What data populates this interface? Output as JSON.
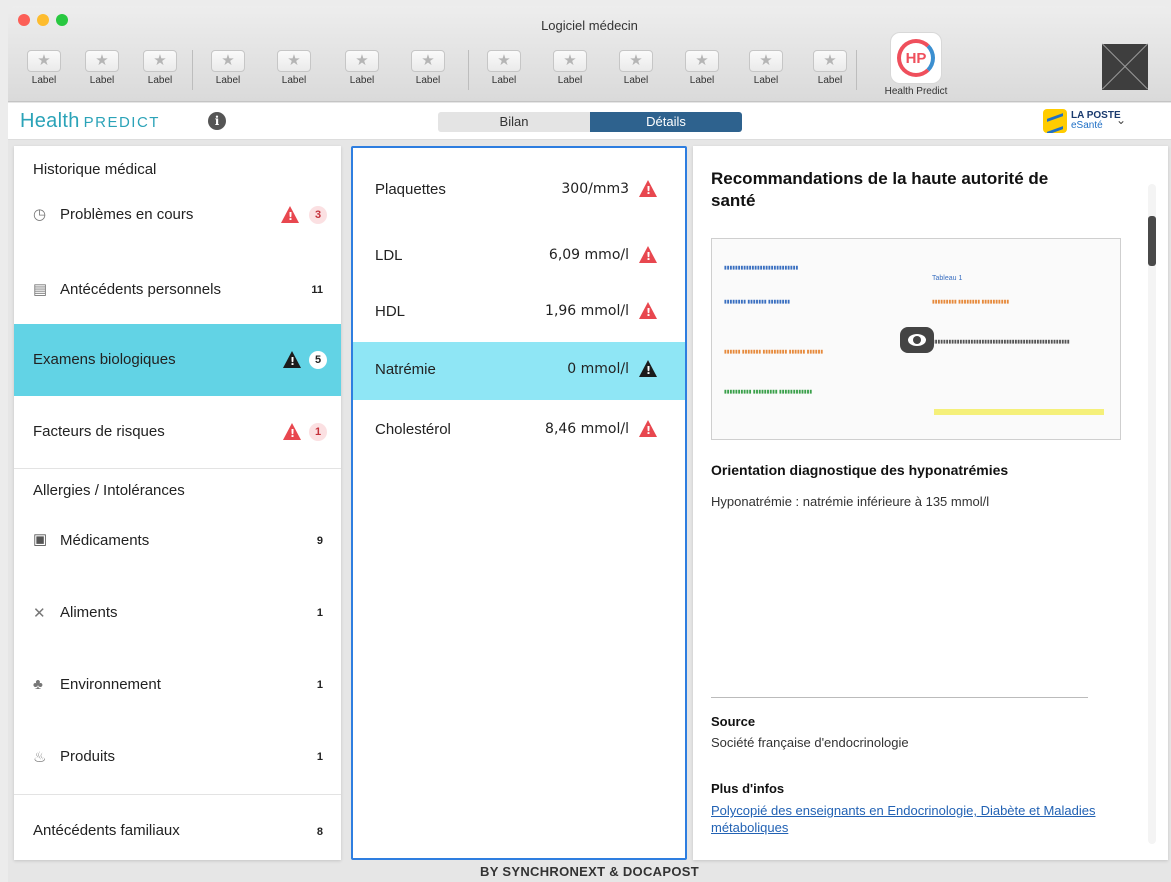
{
  "window": {
    "title": "Logiciel médecin"
  },
  "toolbar": {
    "buttons": [
      "Label",
      "Label",
      "Label",
      "Label",
      "Label",
      "Label",
      "Label",
      "Label",
      "Label",
      "Label",
      "Label",
      "Label",
      "Label"
    ],
    "app_label": "Health Predict",
    "app_logo_text": "HP"
  },
  "header": {
    "brand_main": "Health",
    "brand_sub": "PREDICT",
    "info_icon": "i",
    "tabs": [
      "Bilan",
      "Détails"
    ],
    "active_tab": "Détails",
    "partner_line1": "LA POSTE",
    "partner_line2": "eSanté",
    "chevron": "⌄"
  },
  "sidebar": {
    "history_title": "Historique médical",
    "problems": {
      "label": "Problèmes en cours",
      "count": "3"
    },
    "antecedents": {
      "label": "Antécédents personnels",
      "count": "11"
    },
    "exams": {
      "label": "Examens biologiques",
      "count": "5"
    },
    "risks": {
      "label": "Facteurs de risques",
      "count": "1"
    },
    "allergies_title": "Allergies / Intolérances",
    "medicaments": {
      "label": "Médicaments",
      "count": "9"
    },
    "aliments": {
      "label": "Aliments",
      "count": "1"
    },
    "environnement": {
      "label": "Environnement",
      "count": "1"
    },
    "produits": {
      "label": "Produits",
      "count": "1"
    },
    "familiaux": {
      "label": "Antécédents familiaux",
      "count": "8"
    }
  },
  "exams_list": [
    {
      "name": "Plaquettes",
      "value": "300/mm3"
    },
    {
      "name": "LDL",
      "value": "6,09 mmo/l"
    },
    {
      "name": "HDL",
      "value": "1,96 mmol/l"
    },
    {
      "name": "Natrémie",
      "value": "0 mmol/l"
    },
    {
      "name": "Cholestérol",
      "value": "8,46 mmol/l"
    }
  ],
  "details": {
    "title": "Recommandations de la haute autorité de santé",
    "image_caption": "Tableau 1",
    "subtitle": "Orientation diagnostique des hyponatrémies",
    "body": "Hyponatrémie : natrémie inférieure à 135 mmol/l",
    "source_label": "Source",
    "source": "Société française d'endocrinologie",
    "more_label": "Plus d'infos",
    "link": "Polycopié des enseignants en Endocrinologie, Diabète et Maladies métaboliques"
  },
  "footer": "BY SYNCHRONEXT & DOCAPOST",
  "colors": {
    "accent": "#2e628e",
    "active_row": "#62d3e5",
    "selected_exam": "#8fe6f5",
    "warning": "#e8474f",
    "brand": "#2ba3b8"
  }
}
